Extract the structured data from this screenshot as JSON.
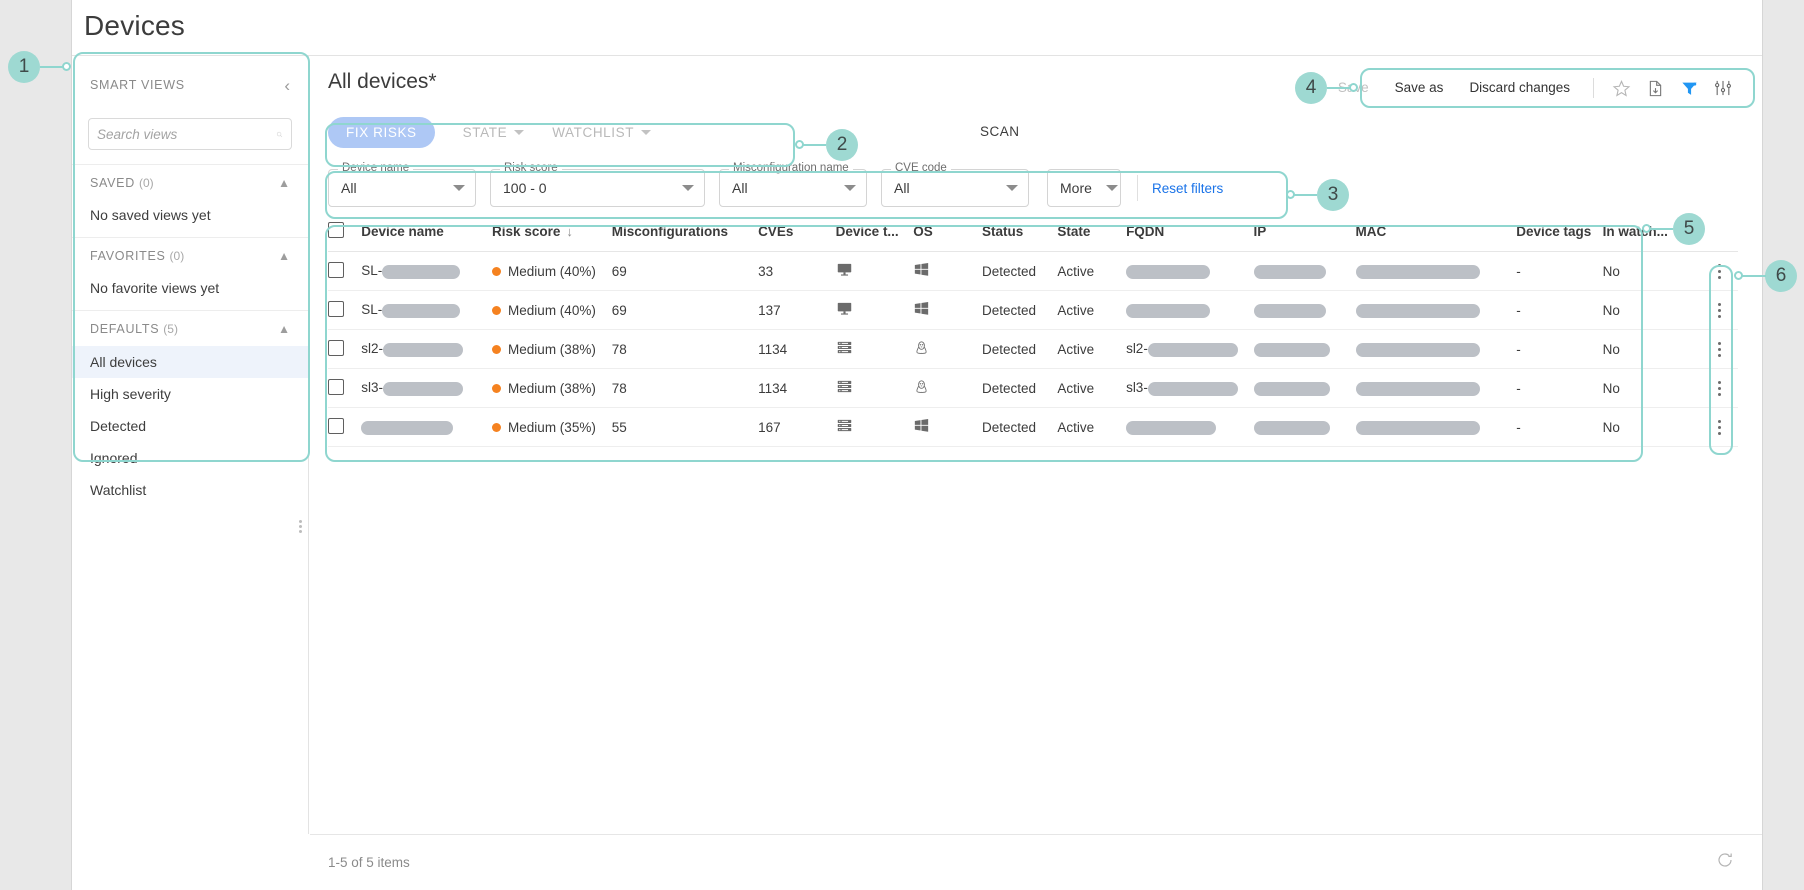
{
  "page": {
    "title": "Devices"
  },
  "sidebar": {
    "header": "SMART VIEWS",
    "collapse_icon": "chevron-left-icon",
    "search": {
      "placeholder": "Search views",
      "value": "",
      "icon": "search-icon"
    },
    "groups": [
      {
        "label": "SAVED",
        "count": "(0)",
        "empty": "No saved views yet",
        "items": []
      },
      {
        "label": "FAVORITES",
        "count": "(0)",
        "empty": "No favorite views yet",
        "items": []
      },
      {
        "label": "DEFAULTS",
        "count": "(5)",
        "empty": "",
        "items": [
          "All devices",
          "High severity",
          "Detected",
          "Ignored",
          "Watchlist"
        ],
        "active": "All devices"
      }
    ]
  },
  "main": {
    "view_title": "All devices*",
    "toolbar": {
      "save": "Save",
      "save_as": "Save as",
      "discard": "Discard changes",
      "icons": [
        "star-icon",
        "export-file-icon",
        "filter-funnel-icon",
        "column-settings-icon"
      ],
      "filter_icon_color": "#2196f3"
    },
    "tabs": {
      "primary": "FIX RISKS",
      "primary_color": "#aec8f5",
      "state": "STATE",
      "watchlist": "WATCHLIST",
      "scan": "SCAN"
    },
    "filters": [
      {
        "label": "Device name",
        "value": "All"
      },
      {
        "label": "Risk score",
        "value": "100 - 0"
      },
      {
        "label": "Misconfiguration name",
        "value": "All"
      },
      {
        "label": "CVE code",
        "value": "All"
      }
    ],
    "more_label": "More",
    "reset_label": "Reset filters",
    "reset_color": "#1a73e8"
  },
  "table": {
    "columns": [
      "Device name",
      "Risk score",
      "Misconfigurations",
      "CVEs",
      "Device t...",
      "OS",
      "Status",
      "State",
      "FQDN",
      "IP",
      "MAC",
      "Device tags",
      "In watch..."
    ],
    "sorted_column": "Risk score",
    "sort_direction": "desc",
    "rows": [
      {
        "device_prefix": "SL-",
        "device_redact_w": 78,
        "risk": "Medium (40%)",
        "risk_color": "#f58220",
        "misconfigurations": "69",
        "cves": "33",
        "device_type": "desktop-icon",
        "os": "windows-icon",
        "status": "Detected",
        "state": "Active",
        "fqdn_prefix": "",
        "fqdn_redact_w": 84,
        "ip_redact_w": 72,
        "mac_redact_w": 124,
        "device_tags": "-",
        "in_watchlist": "No"
      },
      {
        "device_prefix": "SL-",
        "device_redact_w": 78,
        "risk": "Medium (40%)",
        "risk_color": "#f58220",
        "misconfigurations": "69",
        "cves": "137",
        "device_type": "desktop-icon",
        "os": "windows-icon",
        "status": "Detected",
        "state": "Active",
        "fqdn_prefix": "",
        "fqdn_redact_w": 84,
        "ip_redact_w": 72,
        "mac_redact_w": 124,
        "device_tags": "-",
        "in_watchlist": "No"
      },
      {
        "device_prefix": "sl2-",
        "device_redact_w": 80,
        "risk": "Medium (38%)",
        "risk_color": "#f58220",
        "misconfigurations": "78",
        "cves": "1134",
        "device_type": "server-icon",
        "os": "linux-icon",
        "status": "Detected",
        "state": "Active",
        "fqdn_prefix": "sl2-",
        "fqdn_redact_w": 90,
        "ip_redact_w": 76,
        "mac_redact_w": 124,
        "device_tags": "-",
        "in_watchlist": "No"
      },
      {
        "device_prefix": "sl3-",
        "device_redact_w": 80,
        "risk": "Medium (38%)",
        "risk_color": "#f58220",
        "misconfigurations": "78",
        "cves": "1134",
        "device_type": "server-icon",
        "os": "linux-icon",
        "status": "Detected",
        "state": "Active",
        "fqdn_prefix": "sl3-",
        "fqdn_redact_w": 90,
        "ip_redact_w": 76,
        "mac_redact_w": 124,
        "device_tags": "-",
        "in_watchlist": "No"
      },
      {
        "device_prefix": "",
        "device_redact_w": 92,
        "risk": "Medium (35%)",
        "risk_color": "#f58220",
        "misconfigurations": "55",
        "cves": "167",
        "device_type": "server-icon",
        "os": "windows-icon",
        "status": "Detected",
        "state": "Active",
        "fqdn_prefix": "",
        "fqdn_redact_w": 90,
        "ip_redact_w": 76,
        "mac_redact_w": 124,
        "device_tags": "-",
        "in_watchlist": "No"
      }
    ]
  },
  "footer": {
    "count_text": "1-5 of 5 items",
    "refresh_icon": "refresh-icon"
  },
  "annotations": {
    "accent": "#9ed9d2",
    "badges": [
      "1",
      "2",
      "3",
      "4",
      "5",
      "6"
    ]
  }
}
